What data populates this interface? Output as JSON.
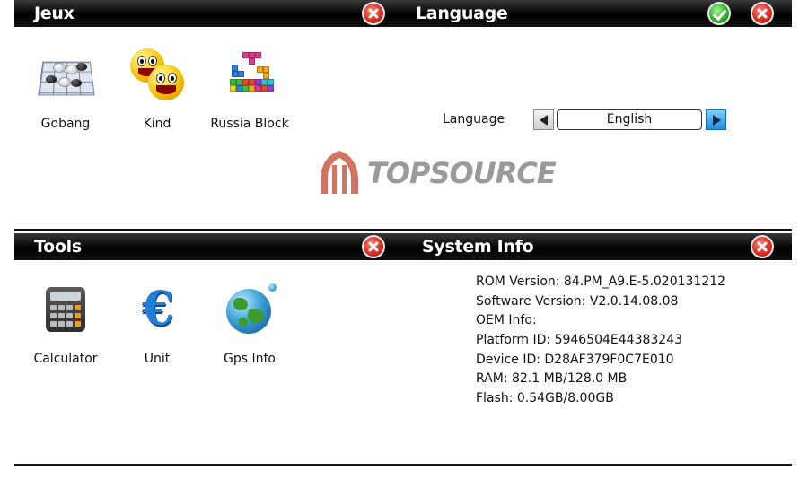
{
  "panels": {
    "games": {
      "title": "Jeux",
      "apps": [
        {
          "label": "Gobang",
          "icon": "gobang-icon"
        },
        {
          "label": "Kind",
          "icon": "smiley-faces-icon"
        },
        {
          "label": "Russia Block",
          "icon": "tetris-blocks-icon"
        }
      ]
    },
    "language": {
      "title": "Language",
      "field_label": "Language",
      "selected_value": "English",
      "prev_icon": "arrow-left-icon",
      "next_icon": "arrow-right-icon"
    },
    "tools": {
      "title": "Tools",
      "apps": [
        {
          "label": "Calculator",
          "icon": "calculator-icon"
        },
        {
          "label": "Unit",
          "icon": "currency-unit-icon"
        },
        {
          "label": "Gps Info",
          "icon": "globe-icon"
        }
      ]
    },
    "system_info": {
      "title": "System Info",
      "lines": [
        "ROM Version: 84.PM_A9.E-5.020131212",
        "Software Version: V2.0.14.08.08",
        "OEM Info:",
        "Platform ID: 5946504E44383243",
        "Device ID: D28AF379F0C7E010",
        "RAM: 82.1 MB/128.0 MB",
        "Flash: 0.54GB/8.00GB"
      ]
    }
  },
  "watermark": {
    "text": "TOPSOURCE",
    "color": "#9a9a9a",
    "accent_color": "#c8503a"
  },
  "colors": {
    "titlebar": "#000000",
    "close_button": "#e03b2e",
    "ok_button": "#36b32f",
    "next_arrow": "#1f8bd8"
  }
}
